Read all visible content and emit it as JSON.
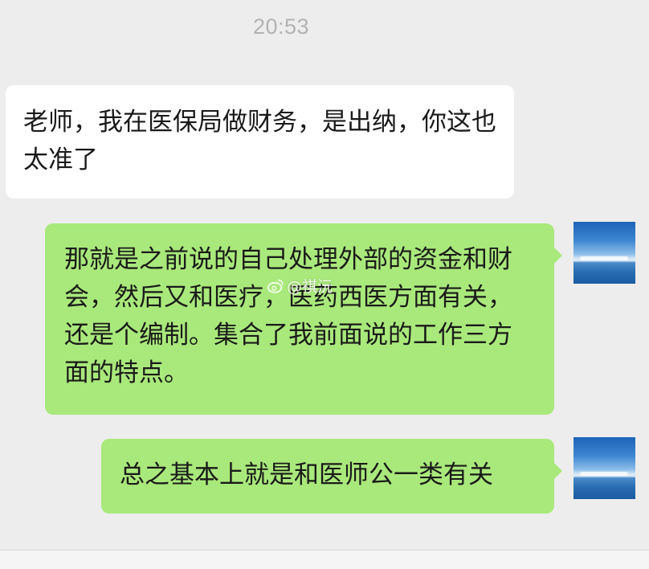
{
  "timestamp": "20:53",
  "messages": [
    {
      "side": "left",
      "text": "老师，我在医保局做财务，是出纳，你这也太准了"
    },
    {
      "side": "right",
      "text": "那就是之前说的自己处理外部的资金和财会，然后又和医疗，医药西医方面有关，还是个编制。集合了我前面说的工作三方面的特点。"
    },
    {
      "side": "right",
      "text": "总之基本上就是和医师公一类有关"
    }
  ],
  "watermark": {
    "text": "@祺沅",
    "icon": "weibo-icon"
  },
  "colors": {
    "background": "#ededed",
    "incoming_bubble": "#ffffff",
    "outgoing_bubble": "#a9e97b",
    "timestamp_text": "#b2b2b2"
  }
}
